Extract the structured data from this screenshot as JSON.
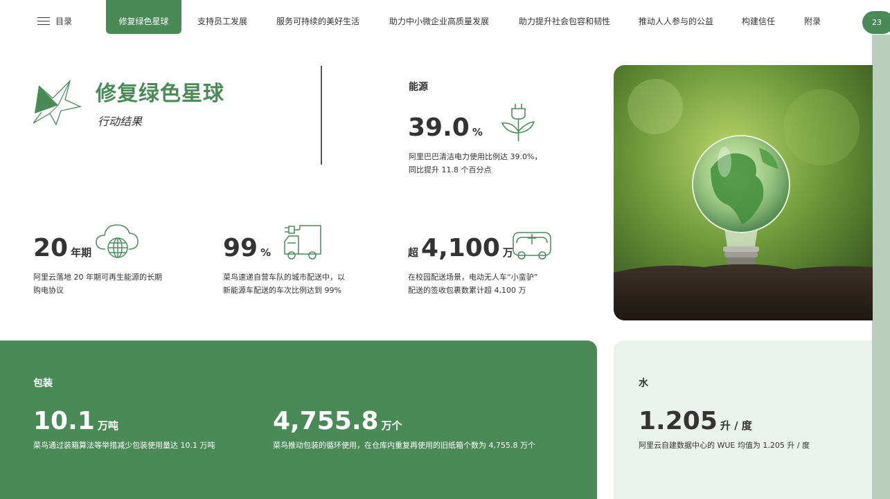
{
  "nav": {
    "menu_label": "目录",
    "items": [
      "修复绿色星球",
      "支持员工发展",
      "服务可持续的美好生活",
      "助力中小微企业高质量发展",
      "助力提升社会包容和韧性",
      "推动人人参与的公益",
      "构建信任",
      "附录"
    ],
    "active_index": 0,
    "page_number": "23"
  },
  "header": {
    "title": "修复绿色星球",
    "subtitle": "行动结果"
  },
  "energy": {
    "label": "能源",
    "value": "39.0",
    "unit": "%",
    "desc_line1": "阿里巴巴清洁电力使用比例达 39.0%，",
    "desc_line2": "同比提升 11.8 个百分点"
  },
  "stats": [
    {
      "prefix": "",
      "value": "20",
      "unit": "年期",
      "line1": "阿里云落地 20 年期可再生能源的长期",
      "line2": "购电协议"
    },
    {
      "prefix": "",
      "value": "99",
      "unit": "%",
      "line1": "菜鸟速递自营车队的城市配送中，以",
      "line2": "新能源车配送的车次比例达到 99%"
    },
    {
      "prefix": "超",
      "value": "4,100",
      "unit": "万",
      "line1": "在校园配送场景，电动无人车“小蛮驴”",
      "line2": "配送的签收包裹数累计超 4,100 万"
    }
  ],
  "packaging": {
    "label": "包装",
    "items": [
      {
        "value": "10.1",
        "unit": "万吨",
        "desc": "菜鸟通过装箱算法等举措减少包装使用量达 10.1 万吨"
      },
      {
        "value": "4,755.8",
        "unit": "万个",
        "desc": "菜鸟推动包装的循环使用，在仓库内重复再使用的旧纸箱个数为 4,755.8 万个"
      }
    ]
  },
  "water": {
    "label": "水",
    "value": "1.205",
    "unit": "升 / 度",
    "desc": "阿里云自建数据中心的 WUE 均值为 1.205 升 / 度"
  },
  "colors": {
    "brand_green": "#4a8a57",
    "light_panel": "#ebf1ec",
    "side_strip": "#b9cfbd"
  },
  "icons": [
    "menu-icon",
    "star-logo-icon",
    "plug-plant-icon",
    "cloud-globe-icon",
    "electric-truck-icon",
    "autonomous-vehicle-icon"
  ]
}
